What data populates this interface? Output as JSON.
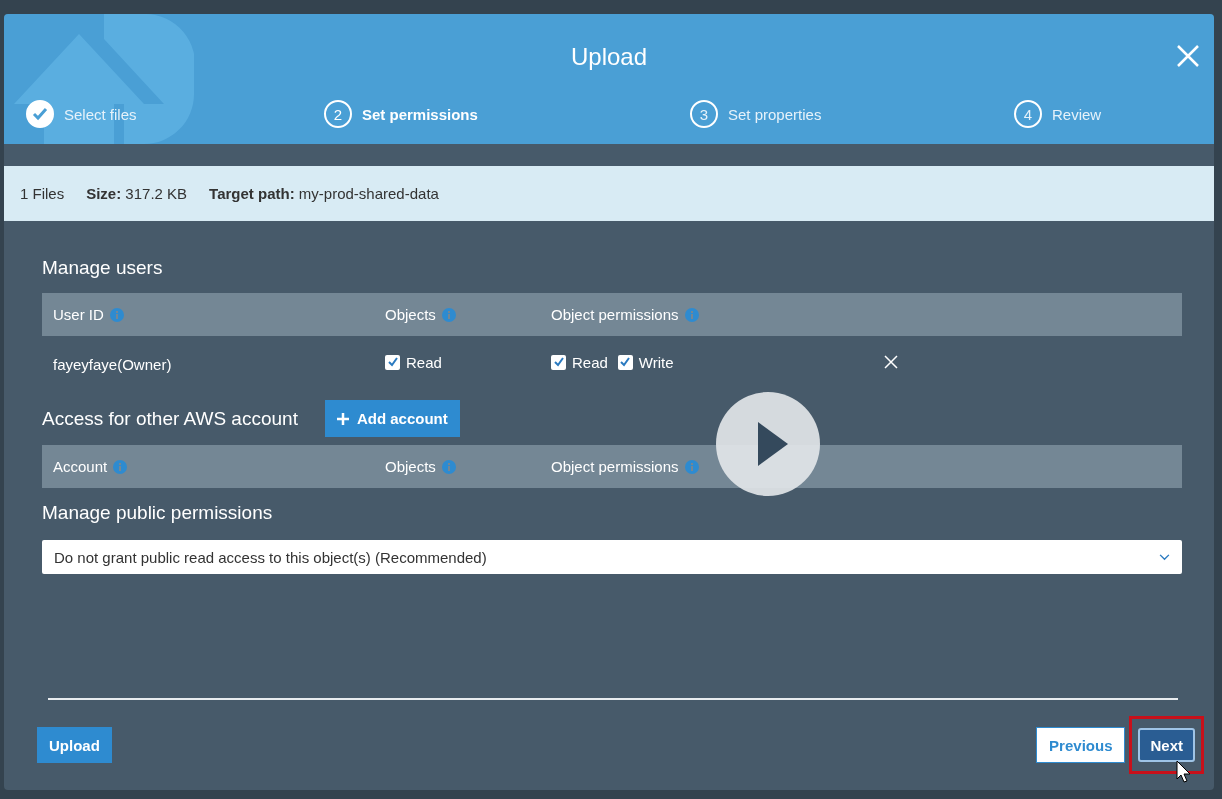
{
  "dialog": {
    "title": "Upload"
  },
  "steps": [
    {
      "label": "Select files",
      "completed": true,
      "selected": false
    },
    {
      "number": "2",
      "label": "Set permissions",
      "completed": false,
      "selected": true
    },
    {
      "number": "3",
      "label": "Set properties",
      "completed": false,
      "selected": false
    },
    {
      "number": "4",
      "label": "Review",
      "completed": false,
      "selected": false
    }
  ],
  "summary": {
    "files": "1 Files",
    "size_label": "Size:",
    "size": "317.2 KB",
    "path_label": "Target path:",
    "path": "my-prod-shared-data"
  },
  "manage_users": {
    "title": "Manage users",
    "columns": [
      "User ID",
      "Objects",
      "Object permissions"
    ],
    "rows": [
      {
        "user": "fayeyfaye(Owner)",
        "object_read": {
          "label": "Read",
          "checked": true
        },
        "perm_read": {
          "label": "Read",
          "checked": true
        },
        "perm_write": {
          "label": "Write",
          "checked": true
        }
      }
    ]
  },
  "other_accounts": {
    "title": "Access for other AWS account",
    "add_button": "Add account",
    "columns": [
      "Account",
      "Objects",
      "Object permissions"
    ]
  },
  "public": {
    "title": "Manage public permissions",
    "value": "Do not grant public read access to this object(s) (Recommended)"
  },
  "buttons": {
    "upload": "Upload",
    "previous": "Previous",
    "next": "Next"
  }
}
